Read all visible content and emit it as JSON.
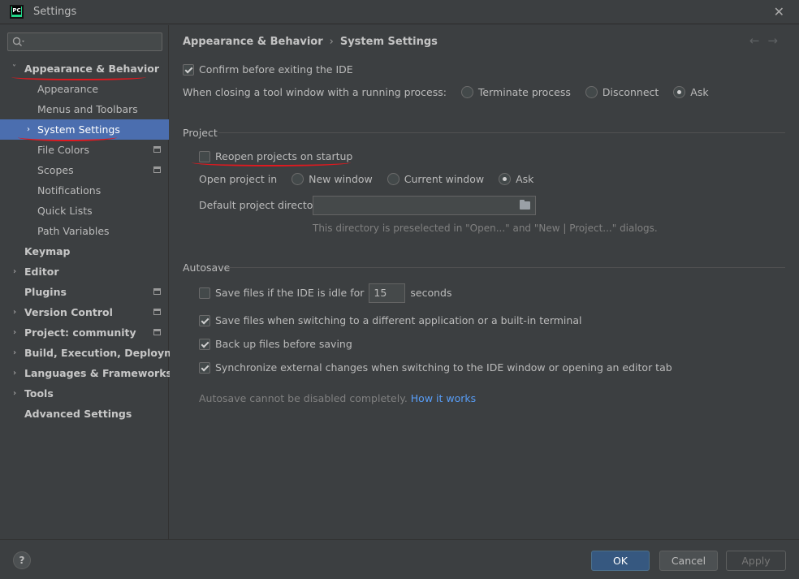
{
  "window": {
    "title": "Settings",
    "logo_text": "PC"
  },
  "sidebar": {
    "search": {
      "value": "",
      "placeholder": ""
    },
    "items": [
      {
        "label": "Appearance & Behavior",
        "expanded": true
      },
      {
        "label": "Appearance"
      },
      {
        "label": "Menus and Toolbars"
      },
      {
        "label": "System Settings",
        "selected": true
      },
      {
        "label": "File Colors"
      },
      {
        "label": "Scopes"
      },
      {
        "label": "Notifications"
      },
      {
        "label": "Quick Lists"
      },
      {
        "label": "Path Variables"
      },
      {
        "label": "Keymap"
      },
      {
        "label": "Editor"
      },
      {
        "label": "Plugins"
      },
      {
        "label": "Version Control"
      },
      {
        "label": "Project: community"
      },
      {
        "label": "Build, Execution, Deployment"
      },
      {
        "label": "Languages & Frameworks"
      },
      {
        "label": "Tools"
      },
      {
        "label": "Advanced Settings"
      }
    ]
  },
  "breadcrumb": {
    "parent": "Appearance & Behavior",
    "separator": "›",
    "current": "System Settings"
  },
  "general": {
    "confirm_exit": {
      "label": "Confirm before exiting the IDE",
      "checked": true
    },
    "closing_tool_window": {
      "label": "When closing a tool window with a running process:",
      "options": [
        "Terminate process",
        "Disconnect",
        "Ask"
      ],
      "selected": "Ask"
    }
  },
  "project": {
    "title": "Project",
    "reopen": {
      "label": "Reopen projects on startup",
      "checked": false
    },
    "open_in": {
      "label": "Open project in",
      "options": [
        "New window",
        "Current window",
        "Ask"
      ],
      "selected": "Ask"
    },
    "default_dir": {
      "label": "Default project directory:",
      "value": "",
      "hint": "This directory is preselected in \"Open...\" and \"New | Project...\" dialogs."
    }
  },
  "autosave": {
    "title": "Autosave",
    "idle": {
      "label_before": "Save files if the IDE is idle for",
      "value": "15",
      "label_after": "seconds",
      "checked": false
    },
    "switch_app": {
      "label": "Save files when switching to a different application or a built-in terminal",
      "checked": true
    },
    "backup": {
      "label": "Back up files before saving",
      "checked": true
    },
    "sync": {
      "label": "Synchronize external changes when switching to the IDE window or opening an editor tab",
      "checked": true
    },
    "note": "Autosave cannot be disabled completely.",
    "link": "How it works"
  },
  "footer": {
    "help": "?",
    "ok": "OK",
    "cancel": "Cancel",
    "apply": "Apply"
  },
  "colors": {
    "selection": "#4b6eaf",
    "accent_red": "#e0191f",
    "link": "#589df6"
  }
}
